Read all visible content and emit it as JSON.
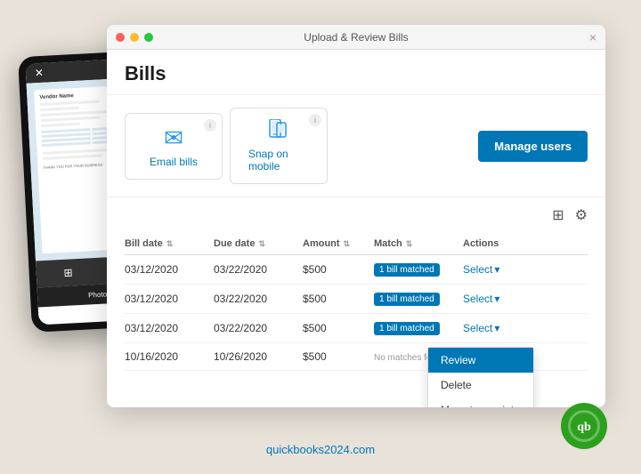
{
  "window": {
    "title": "Upload & Review Bills",
    "close_label": "×"
  },
  "bills": {
    "page_title": "Bills",
    "manage_users_label": "Manage users",
    "upload_options": [
      {
        "id": "email",
        "label": "Email bills",
        "icon": "✉"
      },
      {
        "id": "mobile",
        "label": "Snap on mobile",
        "icon": "📱"
      }
    ],
    "table": {
      "columns": [
        "Bill date",
        "Due date",
        "Amount",
        "Match",
        "Actions"
      ],
      "rows": [
        {
          "bill_date": "03/12/2020",
          "due_date": "03/22/2020",
          "amount": "$500",
          "match": "1 bill matched",
          "has_match": true,
          "show_dropdown": false
        },
        {
          "bill_date": "03/12/2020",
          "due_date": "03/22/2020",
          "amount": "$500",
          "match": "1 bill matched",
          "has_match": true,
          "show_dropdown": false
        },
        {
          "bill_date": "03/12/2020",
          "due_date": "03/22/2020",
          "amount": "$500",
          "match": "1 bill matched",
          "has_match": true,
          "show_dropdown": true
        },
        {
          "bill_date": "10/16/2020",
          "due_date": "10/26/2020",
          "amount": "$500",
          "match": "No matches found",
          "has_match": false,
          "show_dropdown": false
        }
      ],
      "select_label": "Select",
      "dropdown_items": [
        "Review",
        "Delete",
        "Move to receipts"
      ]
    }
  },
  "footer": {
    "website": "quickbooks2024.com"
  },
  "phone": {
    "photos_label": "Photos"
  }
}
